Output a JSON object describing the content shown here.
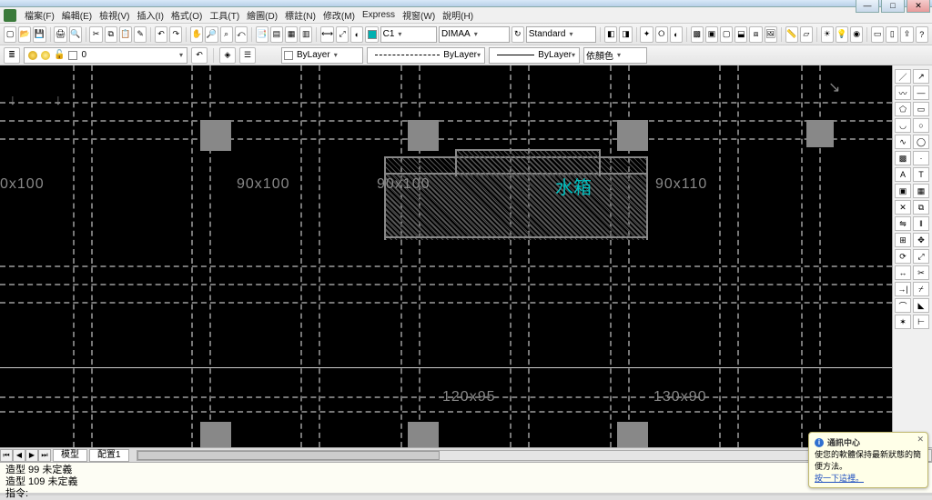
{
  "menu": {
    "items": [
      "檔案(F)",
      "編輯(E)",
      "檢視(V)",
      "插入(I)",
      "格式(O)",
      "工具(T)",
      "繪圖(D)",
      "標註(N)",
      "修改(M)",
      "Express",
      "視窗(W)",
      "說明(H)"
    ]
  },
  "toolbar1": {
    "dimstyle": "DIMAA",
    "textstyle": "Standard",
    "layerlabel": "C1"
  },
  "layerbar": {
    "current_layer": "0",
    "color_control": "ByLayer",
    "linetype_control": "ByLayer",
    "lineweight_control": "ByLayer",
    "plot_style": "依顏色"
  },
  "canvas": {
    "dim_labels": {
      "a": "0x100",
      "b": "90x100",
      "c": "90x100",
      "d": "90x110",
      "e": "120x95",
      "f": "130x90"
    },
    "cn_label": "水箱"
  },
  "tabs": {
    "model": "模型",
    "layout1": "配置1"
  },
  "command": {
    "line1": "造型 99 未定義",
    "line2": "造型 109 未定義",
    "prompt": "指令:"
  },
  "tip": {
    "title": "通訊中心",
    "body": "使您的軟體保持最新狀態的簡便方法。",
    "link": "按一下這裡。"
  }
}
